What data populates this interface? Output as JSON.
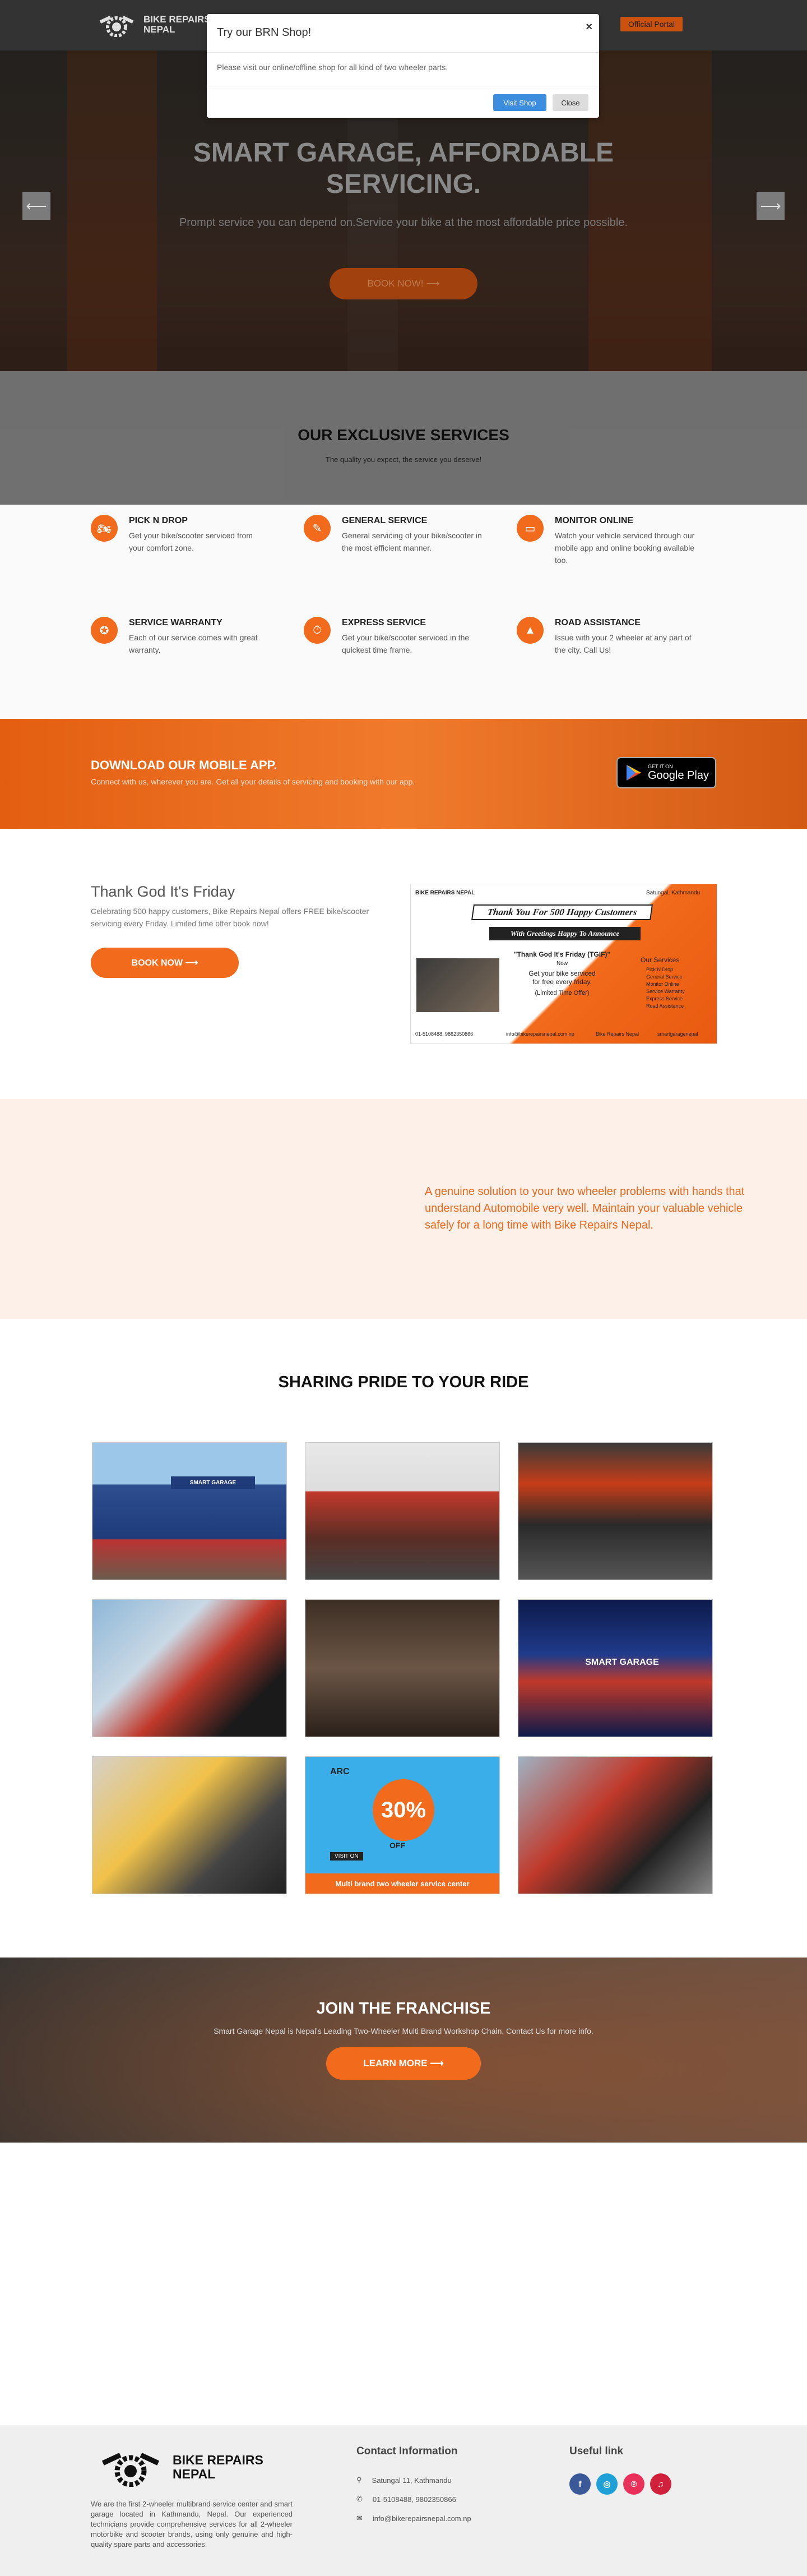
{
  "header": {
    "brand": "BIKE REPAIRS NEPAL",
    "right_button": "Official Portal"
  },
  "popup": {
    "title": "Try our BRN Shop!",
    "close_symbol": "×",
    "body": "Please visit our online/offline shop for all kind of two wheeler parts.",
    "visit_button": "Visit Shop",
    "close_button": "Close"
  },
  "hero": {
    "title_line1": "SMART GARAGE, AFFORDABLE",
    "title_line2": "SERVICING.",
    "subtitle": "Prompt service you can depend on.Service your bike at the most affordable price possible.",
    "button": "BOOK NOW! ⟶",
    "prev_arrow": "⟵",
    "next_arrow": "⟶"
  },
  "services": {
    "title": "OUR EXCLUSIVE SERVICES",
    "subtitle": "The quality you expect, the service you deserve!",
    "items": [
      {
        "name": "PICK N DROP",
        "desc": "Get your bike/scooter serviced from your comfort zone.",
        "icon": "motorcycle-icon"
      },
      {
        "name": "GENERAL SERVICE",
        "desc": "General servicing of your bike/scooter in the most efficient manner.",
        "icon": "wrench-icon"
      },
      {
        "name": "MONITOR ONLINE",
        "desc": "Watch your vehicle serviced through our mobile app and online booking available too.",
        "icon": "monitor-icon"
      },
      {
        "name": "SERVICE WARRANTY",
        "desc": "Each of our service comes with great warranty.",
        "icon": "warranty-icon"
      },
      {
        "name": "EXPRESS SERVICE",
        "desc": "Get your bike/scooter serviced in the quickest time frame.",
        "icon": "clock-icon"
      },
      {
        "name": "ROAD ASSISTANCE",
        "desc": "Issue with your 2 wheeler at any part of the city. Call Us!",
        "icon": "roadblock-icon"
      }
    ]
  },
  "app": {
    "title": "DOWNLOAD OUR MOBILE APP.",
    "subtitle": "Connect with us, wherever you are. Get all your details of servicing and booking with our app.",
    "badge_small": "GET IT ON",
    "badge_big": "Google Play"
  },
  "tgif": {
    "title": "Thank God It's Friday",
    "text": "Celebrating 500 happy customers, Bike Repairs Nepal offers FREE bike/scooter servicing every Friday. Limited time offer book now!",
    "button": "BOOK NOW ⟶",
    "poster": {
      "brand": "BIKE REPAIRS NEPAL",
      "location": "Satungal, Kathmandu",
      "banner": "Thank You For 500 Happy Customers",
      "greeting": "With Greetings Happy To Announce",
      "offer_title": "\"Thank God It's Friday (TGIF)\"",
      "offer_now": "Now",
      "offer_line1": "Get your bike serviced",
      "offer_line2": "for free every friday.",
      "offer_terms": "(Limited Time Offer)",
      "list_title": "Our Services",
      "list": [
        "Pick N Drop",
        "General Service",
        "Monitor Online",
        "Service Warranty",
        "Express Service",
        "Road Assistance"
      ],
      "phone": "01-5108488, 9862350866",
      "email": "info@bikerepairsnepal.com.np",
      "facebook": "Bike Repairs Nepal",
      "handle": "smartgaragenepal"
    }
  },
  "about": {
    "text": "A genuine solution to your two wheeler problems with hands that understand Automobile very well. Maintain your valuable vehicle safely for a long time with Bike Repairs Nepal."
  },
  "gallery": {
    "title": "SHARING PRIDE TO YOUR RIDE",
    "promo": {
      "brand": "ARC",
      "headline": "30%",
      "sub": "OFF",
      "footer": "Multi brand two wheeler service center",
      "visit": "VISIT ON"
    },
    "garage_sign": "SMART GARAGE"
  },
  "franchise": {
    "title": "JOIN THE FRANCHISE",
    "subtitle": "Smart Garage Nepal is Nepal's Leading Two-Wheeler Multi Brand Workshop Chain. Contact Us for more info.",
    "button": "LEARN MORE ⟶"
  },
  "footer": {
    "brand": "BIKE REPAIRS NEPAL",
    "about": "We are the first 2-wheeler multibrand service center and smart garage located in Kathmandu, Nepal. Our experienced technicians provide comprehensive services for all 2-wheeler motorbike and scooter brands, using only genuine and high-quality spare parts and accessories.",
    "contact_title": "Contact Information",
    "address": "Satungal 11, Kathmandu",
    "phone": "01-5108488, 9802350866",
    "email": "info@bikerepairsnepal.com.np",
    "useful_title": "Useful link",
    "social": [
      {
        "name": "facebook",
        "glyph": "f",
        "color": "#3b5998"
      },
      {
        "name": "instagram",
        "glyph": "◎",
        "color": "#1fa1d8"
      },
      {
        "name": "pinterest",
        "glyph": "℗",
        "color": "#e8305b"
      },
      {
        "name": "tiktok",
        "glyph": "♫",
        "color": "#d0203b"
      }
    ]
  },
  "colors": {
    "accent": "#f26a1b",
    "header_bg": "#3b3b3b",
    "cream_bg": "#fdf0e8"
  }
}
